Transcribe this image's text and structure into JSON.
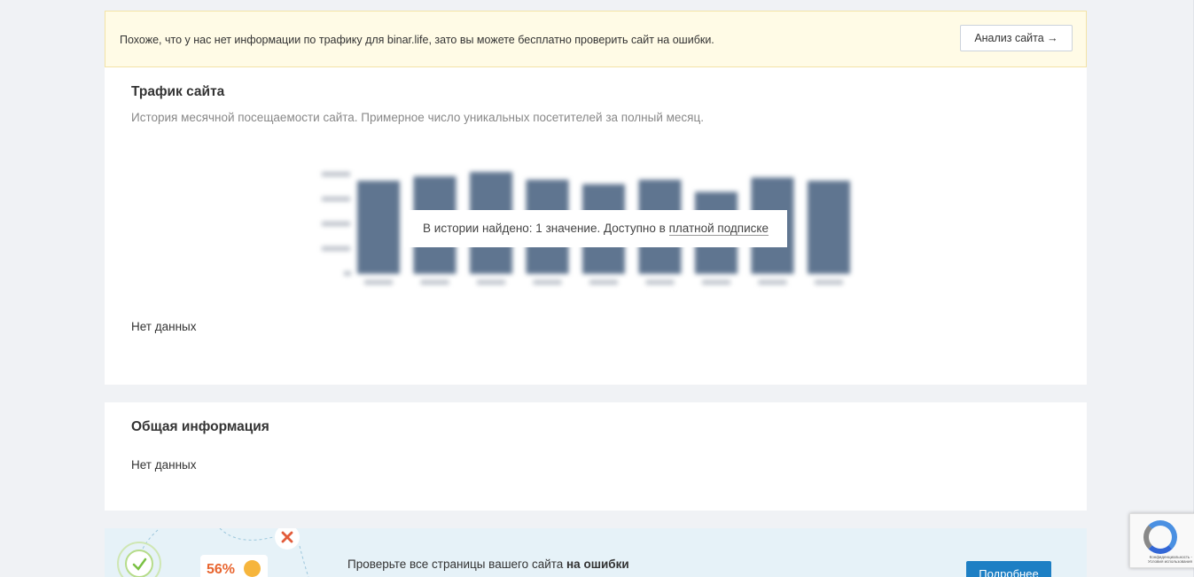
{
  "notice": {
    "text": "Похоже, что у нас нет информации по трафику для binar.life, зато вы можете бесплатно проверить сайт на ошибки.",
    "button_label": "Анализ сайта →"
  },
  "traffic": {
    "title": "Трафик сайта",
    "subtitle": "История месячной посещаемости сайта. Примерное число уникальных посетителей за полный месяц.",
    "overlay_text": "В истории найдено: 1 значение. Доступно в ",
    "overlay_link": "платной подписке",
    "no_data": "Нет данных"
  },
  "general": {
    "title": "Общая информация",
    "no_data": "Нет данных"
  },
  "promo": {
    "percent": "56%",
    "text_prefix": "Проверьте все страницы вашего сайта ",
    "text_bold": "на ошибки",
    "button_label": "Подробнее"
  },
  "recaptcha": {
    "text": "Конфиденциальность - Условия использования"
  },
  "chart_data": {
    "type": "bar",
    "values": [
      0.84,
      0.88,
      0.92,
      0.85,
      0.81,
      0.85,
      0.74,
      0.87,
      0.84
    ],
    "bar_color": "#5f7590"
  },
  "colors": {
    "accent": "#1d7fc4",
    "notice_bg": "#fffbe6",
    "promo_bg": "#e6f2f8",
    "error": "#e25b3a",
    "success": "#7ac143"
  }
}
